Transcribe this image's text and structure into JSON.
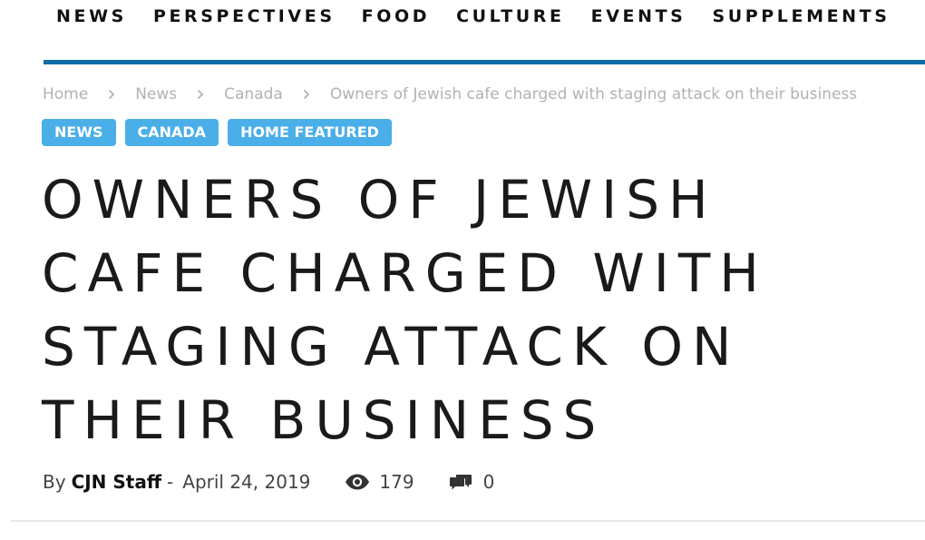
{
  "nav": {
    "items": [
      {
        "label": "NEWS"
      },
      {
        "label": "PERSPECTIVES"
      },
      {
        "label": "FOOD"
      },
      {
        "label": "CULTURE"
      },
      {
        "label": "EVENTS"
      },
      {
        "label": "SUPPLEMENTS"
      }
    ],
    "accent_color": "#0f6ea6"
  },
  "breadcrumb": {
    "items": [
      {
        "label": "Home"
      },
      {
        "label": "News"
      },
      {
        "label": "Canada"
      },
      {
        "label": "Owners of Jewish cafe charged with staging attack on their business"
      }
    ],
    "separator_icon": "chevron-right-icon"
  },
  "tags": {
    "items": [
      {
        "label": "NEWS"
      },
      {
        "label": "CANADA"
      },
      {
        "label": "HOME FEATURED"
      }
    ],
    "color": "#4aaee8"
  },
  "article": {
    "title": "Owners of Jewish cafe charged with staging attack on their business",
    "author_prefix": "By",
    "author": "CJN Staff",
    "date_separator": "-",
    "date": "April 24, 2019",
    "views_icon": "eye-icon",
    "views": "179",
    "comments_icon": "comments-icon",
    "comments": "0"
  }
}
